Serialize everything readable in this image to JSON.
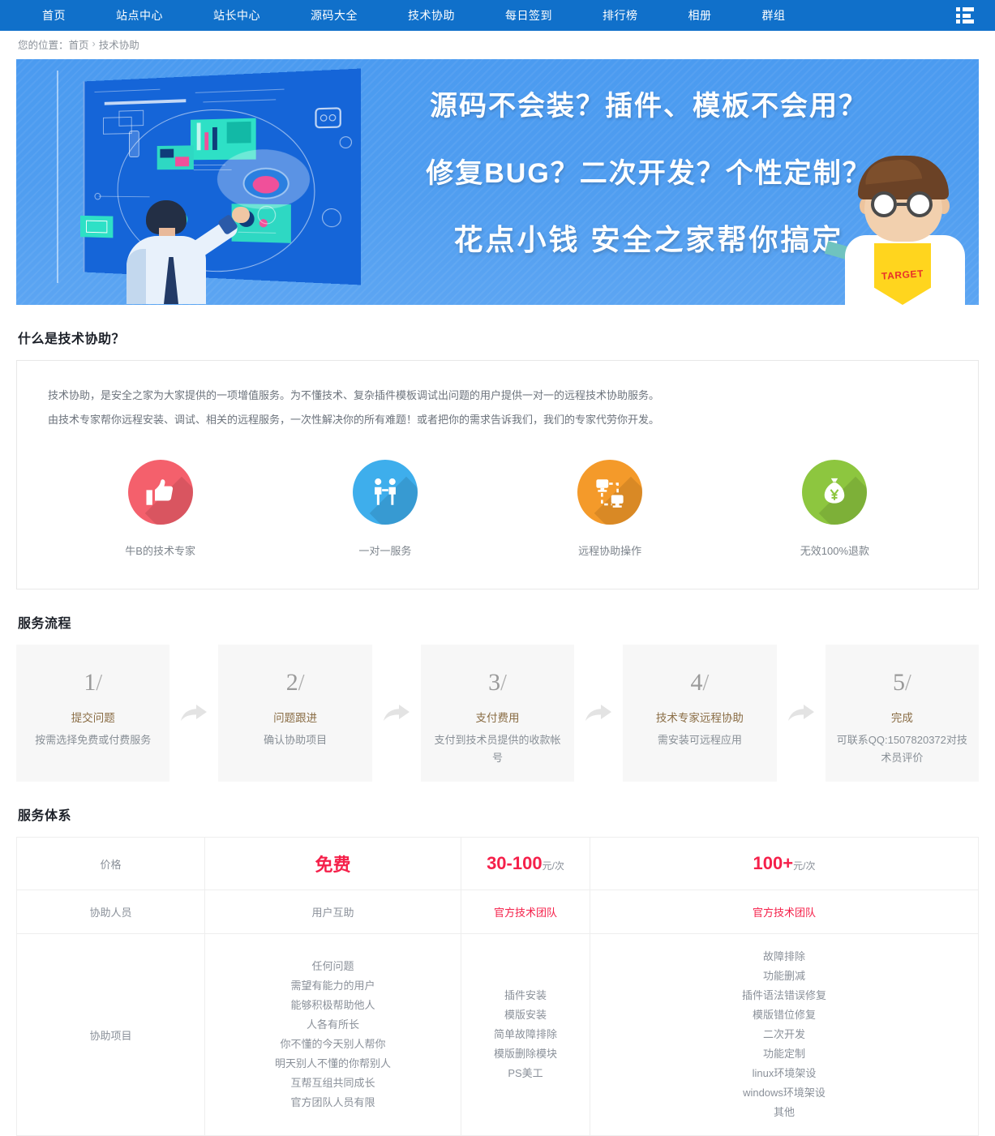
{
  "theme": {
    "nav_bg": "#1070ca",
    "banner_bg": "#4f9df0",
    "accent_red": "#f5204a",
    "step_title": "#8a6d45"
  },
  "nav": {
    "items": [
      {
        "label": "首页",
        "name": "home"
      },
      {
        "label": "站点中心",
        "name": "site-center"
      },
      {
        "label": "站长中心",
        "name": "webmaster-center"
      },
      {
        "label": "源码大全",
        "name": "source-code"
      },
      {
        "label": "技术协助",
        "name": "tech-support"
      },
      {
        "label": "每日签到",
        "name": "daily-checkin"
      },
      {
        "label": "排行榜",
        "name": "ranking"
      },
      {
        "label": "相册",
        "name": "album"
      },
      {
        "label": "群组",
        "name": "groups"
      }
    ],
    "menu_icon": "list-menu-icon"
  },
  "breadcrumb": {
    "prefix": "您的位置：",
    "home": "首页",
    "separator": "›",
    "current": "技术协助"
  },
  "banner": {
    "line1": "源码不会装？插件、模板不会用？",
    "line2": "修复BUG？二次开发？个性定制？",
    "line3": "花点小钱 安全之家帮你搞定",
    "mascot_shirt_text": "TARGET"
  },
  "whatis": {
    "heading": "什么是技术协助？",
    "paragraph1": "技术协助，是安全之家为大家提供的一项增值服务。为不懂技术、复杂插件模板调试出问题的用户提供一对一的远程技术协助服务。",
    "paragraph2": "由技术专家帮你远程安装、调试、相关的远程服务，一次性解决你的所有难题！或者把你的需求告诉我们，我们的专家代劳你开发。",
    "features": [
      {
        "label": "牛B的技术专家",
        "icon": "thumbs-up-icon",
        "color": "#f4606c"
      },
      {
        "label": "一对一服务",
        "icon": "two-people-icon",
        "color": "#3eaeec"
      },
      {
        "label": "远程协助操作",
        "icon": "remote-desktop-icon",
        "color": "#f49a2a"
      },
      {
        "label": "无效100%退款",
        "icon": "money-bag-icon",
        "color": "#8dc63f"
      }
    ]
  },
  "process": {
    "heading": "服务流程",
    "steps": [
      {
        "num": "1",
        "title": "提交问题",
        "desc": "按需选择免费或付费服务"
      },
      {
        "num": "2",
        "title": "问题跟进",
        "desc": "确认协助项目"
      },
      {
        "num": "3",
        "title": "支付费用",
        "desc": "支付到技术员提供的收款帐号"
      },
      {
        "num": "4",
        "title": "技术专家远程协助",
        "desc": "需安装可远程应用"
      },
      {
        "num": "5",
        "title": "完成",
        "desc": "可联系QQ:1507820372对技术员评价"
      }
    ],
    "arrow_icon": "forward-arrow-icon"
  },
  "services": {
    "heading": "服务体系",
    "rows": [
      {
        "label": "价格",
        "free": "免费",
        "mid_value": "30-100",
        "mid_unit": "元/次",
        "high_value": "100+",
        "high_unit": "元/次"
      },
      {
        "label": "协助人员",
        "free": "用户互助",
        "mid": "官方技术团队",
        "high": "官方技术团队"
      },
      {
        "label": "协助项目",
        "free_items": [
          "任何问题",
          "需望有能力的用户",
          "能够积极帮助他人",
          "人各有所长",
          "你不懂的今天别人帮你",
          "明天别人不懂的你帮别人",
          "互帮互组共同成长",
          "官方团队人员有限"
        ],
        "mid_items": [
          "插件安装",
          "模版安装",
          "简单故障排除",
          "模版删除模块",
          "PS美工"
        ],
        "high_items": [
          "故障排除",
          "功能删减",
          "插件语法错误修复",
          "模版错位修复",
          "二次开发",
          "功能定制",
          "linux环境架设",
          "windows环境架设",
          "其他"
        ]
      }
    ]
  }
}
